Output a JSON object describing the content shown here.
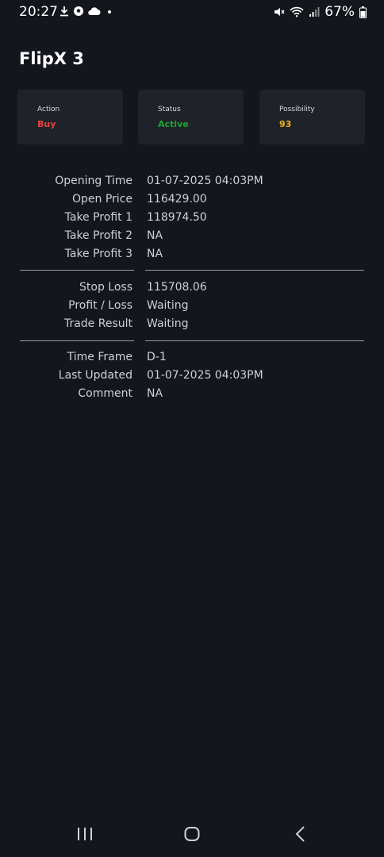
{
  "status_bar": {
    "time": "20:27",
    "battery": "67%",
    "icons_left": [
      "download-icon",
      "soccer-ball-icon",
      "cloud-icon",
      "dot-icon"
    ],
    "icons_right": [
      "mute-icon",
      "wifi-icon",
      "signal-icon",
      "battery-icon"
    ]
  },
  "app": {
    "title": "FlipX 3"
  },
  "cards": [
    {
      "label": "Action",
      "value": "Buy",
      "color": "#e5443c"
    },
    {
      "label": "Status",
      "value": "Active",
      "color": "#1fa531"
    },
    {
      "label": "Possibility",
      "value": "93",
      "color": "#f2b619"
    }
  ],
  "details": {
    "group1": [
      {
        "label": "Opening Time",
        "value": "01-07-2025 04:03PM"
      },
      {
        "label": "Open Price",
        "value": "116429.00"
      },
      {
        "label": "Take Profit 1",
        "value": "118974.50"
      },
      {
        "label": "Take Profit 2",
        "value": "NA"
      },
      {
        "label": "Take Profit 3",
        "value": "NA"
      }
    ],
    "group2": [
      {
        "label": "Stop Loss",
        "value": "115708.06"
      },
      {
        "label": "Profit / Loss",
        "value": "Waiting"
      },
      {
        "label": "Trade Result",
        "value": "Waiting"
      }
    ],
    "group3": [
      {
        "label": "Time Frame",
        "value": "D-1"
      },
      {
        "label": "Last Updated",
        "value": "01-07-2025 04:03PM"
      },
      {
        "label": "Comment",
        "value": "NA"
      }
    ]
  },
  "nav": [
    "recent-apps-icon",
    "home-icon",
    "back-icon"
  ]
}
